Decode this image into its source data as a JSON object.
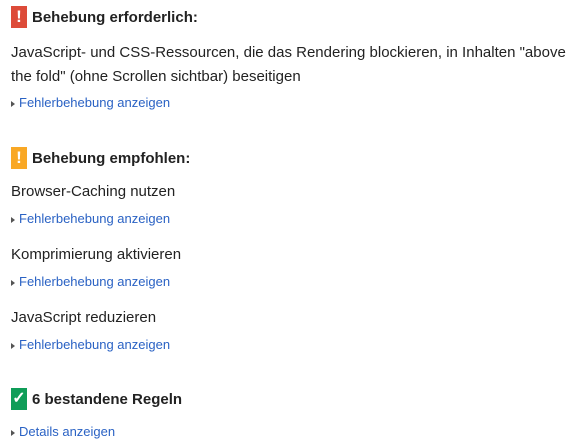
{
  "sections": {
    "required": {
      "title": "Behebung erforderlich:",
      "badge": "!",
      "badge_color": "#dd4b39",
      "rules": [
        {
          "text": "JavaScript- und CSS-Ressourcen, die das Rendering blockieren, in Inhalten \"above the fold\" (ohne Scrollen sichtbar) beseitigen",
          "link": "Fehlerbehebung anzeigen"
        }
      ]
    },
    "recommended": {
      "title": "Behebung empfohlen:",
      "badge": "!",
      "badge_color": "#f9a825",
      "rules": [
        {
          "text": "Browser-Caching nutzen",
          "link": "Fehlerbehebung anzeigen"
        },
        {
          "text": "Komprimierung aktivieren",
          "link": "Fehlerbehebung anzeigen"
        },
        {
          "text": "JavaScript reduzieren",
          "link": "Fehlerbehebung anzeigen"
        }
      ]
    },
    "passed": {
      "title": "6 bestandene Regeln",
      "badge": "✓",
      "badge_color": "#0f9d58",
      "link": "Details anzeigen"
    }
  },
  "colors": {
    "link": "#2a62c4",
    "text": "#222222"
  },
  "icons": {
    "required": "exclamation-icon",
    "recommended": "exclamation-icon",
    "passed": "checkmark-icon",
    "toggle": "caret-right-icon"
  }
}
